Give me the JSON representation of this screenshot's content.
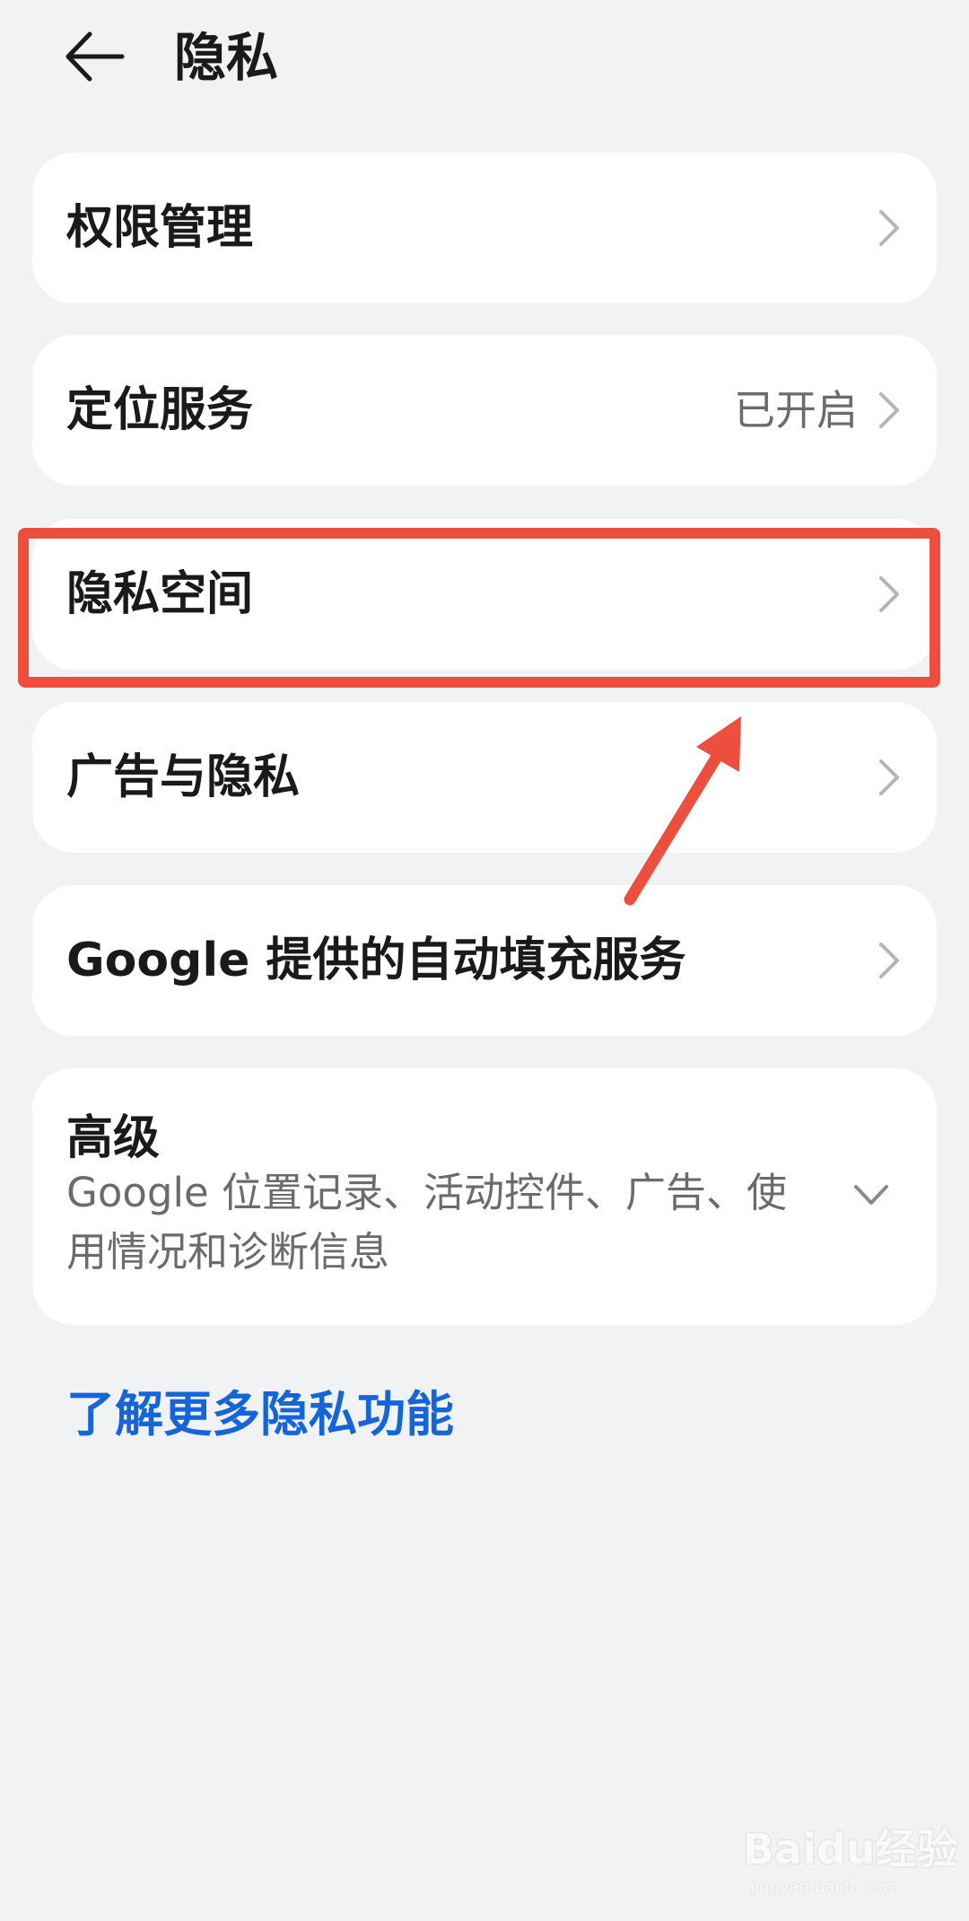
{
  "header": {
    "title": "隐私"
  },
  "rows": [
    {
      "label": "权限管理",
      "value": ""
    },
    {
      "label": "定位服务",
      "value": "已开启"
    },
    {
      "label": "隐私空间",
      "value": ""
    },
    {
      "label": "广告与隐私",
      "value": ""
    },
    {
      "label": "Google 提供的自动填充服务",
      "value": ""
    }
  ],
  "advanced": {
    "title": "高级",
    "subtitle": "Google 位置记录、活动控件、广告、使用情况和诊断信息"
  },
  "learn_more": "了解更多隐私功能",
  "annotation": {
    "highlighted_item": "隐私空间",
    "color": "#ec4f3d"
  },
  "icons": {
    "back": "back-arrow-icon",
    "row_chevron": "chevron-right-icon",
    "expand": "chevron-down-icon"
  },
  "colors": {
    "background": "#f1f2f4",
    "card": "#ffffff",
    "link": "#1565d8",
    "secondary_text": "#6b6b6b"
  },
  "watermark": {
    "brand": "Baidu经验",
    "url": "jingyan.baidu.com"
  }
}
